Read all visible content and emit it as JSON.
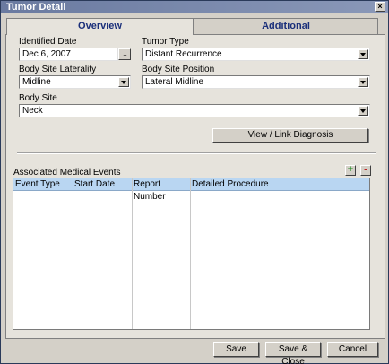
{
  "window": {
    "title": "Tumor Detail",
    "close_glyph": "×"
  },
  "tabs": [
    {
      "label": "Overview",
      "active": true
    },
    {
      "label": "Additional",
      "active": false
    }
  ],
  "form": {
    "identified_date": {
      "label": "Identified Date",
      "value": "Dec 6, 2007",
      "button_glyph": "..."
    },
    "tumor_type": {
      "label": "Tumor Type",
      "value": "Distant Recurrence"
    },
    "body_site_laterality": {
      "label": "Body Site Laterality",
      "value": "Midline"
    },
    "body_site_position": {
      "label": "Body Site Position",
      "value": "Lateral Midline"
    },
    "body_site": {
      "label": "Body Site",
      "value": "Neck"
    },
    "view_link_button": "View / Link Diagnosis"
  },
  "events": {
    "label": "Associated Medical Events",
    "add_glyph": "+",
    "remove_glyph": "-",
    "columns": [
      "Event Type",
      "Start Date",
      "Report Number",
      "Detailed Procedure"
    ],
    "rows": []
  },
  "footer": {
    "save": "Save",
    "save_close": "Save & Close",
    "cancel": "Cancel"
  },
  "colors": {
    "title_bar": "#6a7aa0",
    "tab_text": "#1a2f7a",
    "table_header": "#b9d6f2",
    "add_green": "#1a8a1a",
    "remove_red": "#c02020"
  }
}
